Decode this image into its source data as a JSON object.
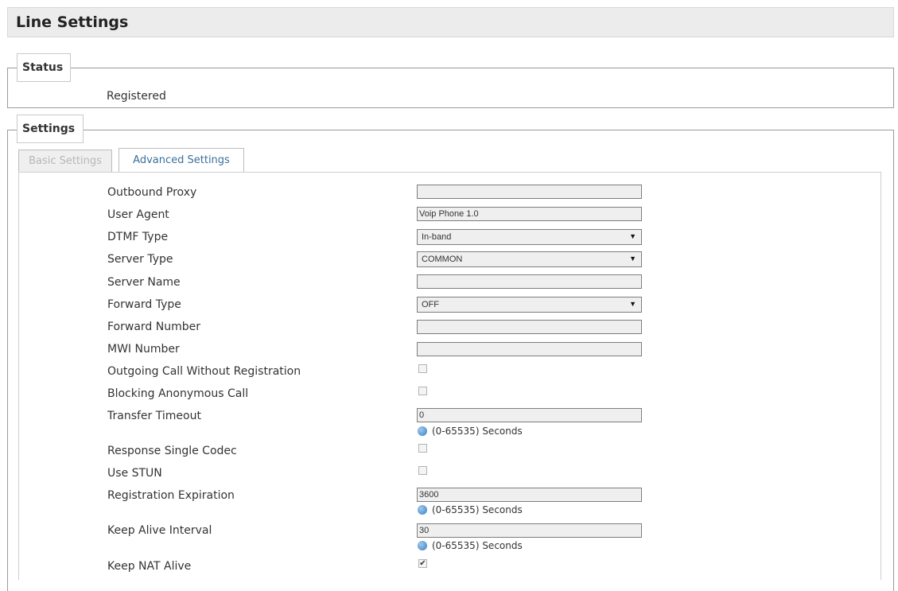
{
  "header": {
    "title": "Line Settings"
  },
  "status": {
    "legend": "Status",
    "value": "Registered"
  },
  "settings": {
    "legend": "Settings",
    "tabs": [
      {
        "label": "Basic Settings",
        "active": false
      },
      {
        "label": "Advanced Settings",
        "active": true
      }
    ]
  },
  "form": {
    "outbound_proxy": {
      "label": "Outbound Proxy",
      "value": ""
    },
    "user_agent": {
      "label": "User Agent",
      "value": "Voip Phone 1.0"
    },
    "dtmf_type": {
      "label": "DTMF Type",
      "value": "In-band"
    },
    "server_type": {
      "label": "Server Type",
      "value": "COMMON"
    },
    "server_name": {
      "label": "Server Name",
      "value": ""
    },
    "forward_type": {
      "label": "Forward Type",
      "value": "OFF"
    },
    "forward_number": {
      "label": "Forward Number",
      "value": ""
    },
    "mwi_number": {
      "label": "MWI Number",
      "value": ""
    },
    "outgoing_without_registration": {
      "label": "Outgoing Call Without Registration",
      "checked": false
    },
    "blocking_anonymous": {
      "label": "Blocking Anonymous Call",
      "checked": false
    },
    "transfer_timeout": {
      "label": "Transfer Timeout",
      "value": "0",
      "hint": "(0-65535) Seconds"
    },
    "response_single_codec": {
      "label": "Response Single Codec",
      "checked": false
    },
    "use_stun": {
      "label": "Use STUN",
      "checked": false
    },
    "registration_expiration": {
      "label": "Registration Expiration",
      "value": "3600",
      "hint": "(0-65535) Seconds"
    },
    "keep_alive_interval": {
      "label": "Keep Alive Interval",
      "value": "30",
      "hint": "(0-65535) Seconds"
    },
    "keep_nat_alive": {
      "label": "Keep NAT Alive",
      "checked": true
    }
  },
  "icons": {
    "info": "info-icon",
    "dropdown": "chevron-down-icon",
    "check": "checkmark-icon"
  },
  "colors": {
    "active_tab_text": "#3a6f9c",
    "title_bar_bg": "#ececec",
    "info_icon": "#3a7fc0"
  }
}
